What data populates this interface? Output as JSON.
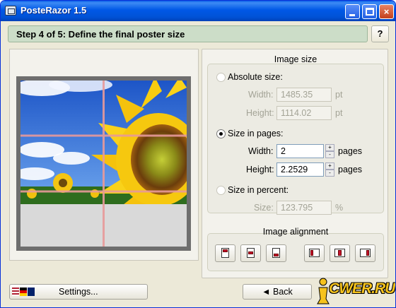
{
  "window": {
    "title": "PosteRazor 1.5",
    "minimize_glyph": "minimize-icon",
    "maximize_glyph": "maximize-icon",
    "close_glyph": "×"
  },
  "step": {
    "label": "Step 4 of 5: Define the final poster size",
    "help_label": "?"
  },
  "image_size": {
    "group_title": "Image size",
    "absolute": {
      "label": "Absolute size:",
      "selected": false,
      "width_label": "Width:",
      "width_value": "1485.35",
      "width_unit": "pt",
      "height_label": "Height:",
      "height_value": "1114.02",
      "height_unit": "pt"
    },
    "pages": {
      "label": "Size in pages:",
      "selected": true,
      "width_label": "Width:",
      "width_value": "2",
      "width_unit": "pages",
      "height_label": "Height:",
      "height_value": "2.2529",
      "height_unit": "pages",
      "spin_up": "+",
      "spin_down": "-"
    },
    "percent": {
      "label": "Size in percent:",
      "selected": false,
      "size_label": "Size:",
      "size_value": "123.795",
      "size_unit": "%"
    }
  },
  "image_alignment": {
    "group_title": "Image alignment",
    "buttons": [
      "align-top-icon",
      "align-vcenter-icon",
      "align-bottom-icon",
      "align-left-icon",
      "align-hcenter-icon",
      "align-right-icon"
    ]
  },
  "footer": {
    "settings_label": "Settings...",
    "back_label": "◄ Back",
    "logo_text": "CWER.RU"
  },
  "colors": {
    "titlebar": "#0058e6",
    "step_bar": "#ccddc8",
    "grid_lines": "#e89a9a",
    "sheet_border": "#6e6e6e"
  }
}
